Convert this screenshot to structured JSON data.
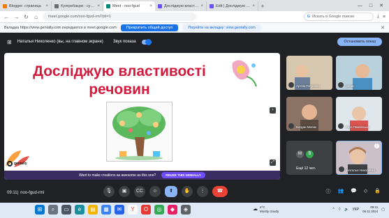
{
  "browser": {
    "tabs": [
      {
        "label": "Blogger: страница",
        "color": "#f57c00",
        "active": false
      },
      {
        "label": "Кулгребаєри - сучасне",
        "color": "#6b6b6b",
        "active": false
      },
      {
        "label": "Meet - noo-fgud",
        "color": "#00897b",
        "active": true
      },
      {
        "label": "Досліджую властивості",
        "color": "#6e4cff",
        "active": false
      },
      {
        "label": "Edit | Досліджую власт",
        "color": "#6e4cff",
        "active": false
      }
    ],
    "url": "meet.google.com/noo-fgud-rmi?pli=1",
    "search_placeholder": "Искать в Google поиске"
  },
  "share_bar": {
    "message": "Вкладка https://view.genially.com передается в meet.google.com",
    "share_button": "Прекратить общий доступ",
    "goto_button": "Перейти на вкладку: view.genially.com"
  },
  "presenter": {
    "name": "Наталья Николенко (вы, на главном экране)",
    "sound_label": "Звук показа",
    "stop_button": "Остановить показ"
  },
  "slide": {
    "title_line1": "Досліджую властивості",
    "title_line2": "речовин",
    "brand": "genially",
    "promo_text": "Want to make creations as awesome as this one?",
    "promo_button": "REUSE THIS GENIALLY"
  },
  "participants": [
    {
      "name": "Артем Петренко",
      "bg": "#c9b9a1"
    },
    {
      "name": "денис",
      "bg": "#8fb4c8"
    },
    {
      "name": "Богдан Мелик",
      "bg": "#a88a79"
    },
    {
      "name": "Катя Павлівська",
      "bg": "#b9c9d2"
    },
    {
      "name": "Наталья Николенко",
      "bg": "#b8a8b4"
    }
  ],
  "more_tile": {
    "label": "Ещё 12 чел.",
    "avatars": [
      {
        "letter": "M",
        "color": "#5f6368"
      },
      {
        "letter": "B",
        "color": "#34a853"
      }
    ]
  },
  "meet_bar": {
    "time": "09:11",
    "code": "noo-fgud-rmi",
    "badge": "18"
  },
  "taskbar": {
    "temperature": "4°C",
    "weather": "Mostly cloudy",
    "lang": "УКР",
    "time": "09:11",
    "date": "06.11.2024"
  }
}
